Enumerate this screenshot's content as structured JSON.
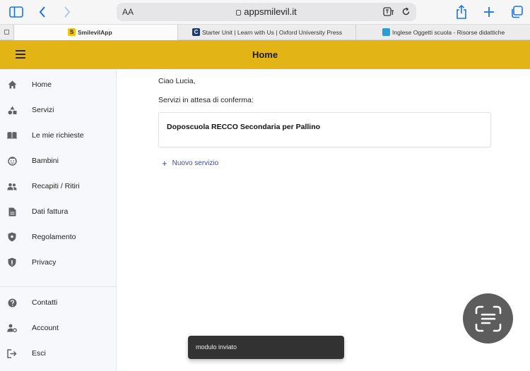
{
  "browser": {
    "text_size_label": "AA",
    "url": "appsmilevil.it",
    "tabs": [
      {
        "label": "SmilevilApp",
        "favicon_text": "S",
        "favicon_color": "#f2c40f"
      },
      {
        "label": "Starter Unit | Learn with Us | Oxford University Press",
        "favicon_text": "C",
        "favicon_color": "#1f3b6e"
      },
      {
        "label": "Inglese Oggetti scuola - Risorse didattiche",
        "favicon_text": "",
        "favicon_color": "#2e9bd6"
      }
    ]
  },
  "appbar": {
    "title": "Home",
    "color": "#e3b416"
  },
  "sidebar": {
    "items": [
      {
        "label": "Home",
        "icon": "home-icon"
      },
      {
        "label": "Servizi",
        "icon": "shapes-icon"
      },
      {
        "label": "Le mie richieste",
        "icon": "book-icon"
      },
      {
        "label": "Bambini",
        "icon": "child-face-icon"
      },
      {
        "label": "Recapiti / Ritiri",
        "icon": "people-icon"
      },
      {
        "label": "Dati fattura",
        "icon": "document-icon"
      },
      {
        "label": "Regolamento",
        "icon": "shield-icon"
      },
      {
        "label": "Privacy",
        "icon": "privacy-shield-icon"
      }
    ],
    "bottom_items": [
      {
        "label": "Contatti",
        "icon": "help-icon"
      },
      {
        "label": "Account",
        "icon": "account-icon"
      },
      {
        "label": "Esci",
        "icon": "logout-icon"
      }
    ]
  },
  "main": {
    "greeting": "Ciao Lucia,",
    "pending_label": "Servizi in attesa di conferma:",
    "pending_services": [
      {
        "title": "Doposcuola RECCO Secondaria per Pallino"
      }
    ],
    "new_service_label": "Nuovo servizio"
  },
  "snackbar": {
    "message": "modulo inviato"
  },
  "colors": {
    "accent": "#3949ab",
    "snackbar": "#323232",
    "browser_blue": "#1a73e8"
  }
}
